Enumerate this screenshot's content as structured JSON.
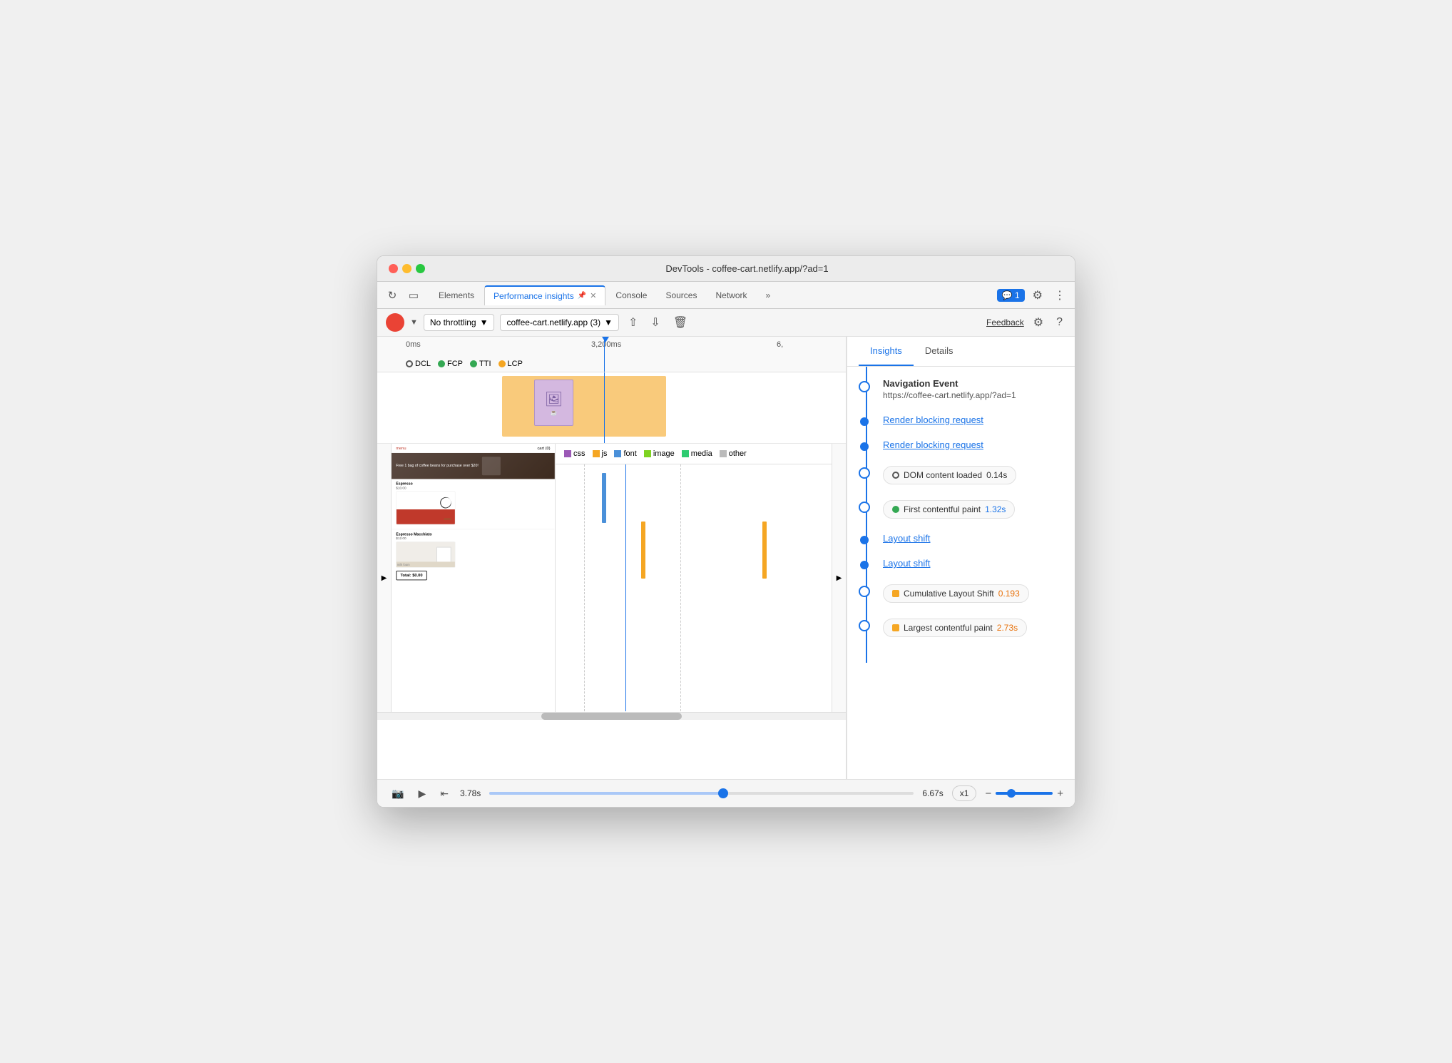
{
  "window": {
    "title": "DevTools - coffee-cart.netlify.app/?ad=1"
  },
  "tabs": {
    "items": [
      {
        "label": "Elements",
        "active": false,
        "closable": false
      },
      {
        "label": "Performance insights",
        "active": true,
        "closable": true,
        "pinned": true
      },
      {
        "label": "Console",
        "active": false,
        "closable": false
      },
      {
        "label": "Sources",
        "active": false,
        "closable": false
      },
      {
        "label": "Network",
        "active": false,
        "closable": false
      },
      {
        "label": "More tabs",
        "active": false
      }
    ],
    "right_buttons": {
      "chat_badge": "1",
      "gear": "⚙",
      "more": "⋮"
    }
  },
  "toolbar": {
    "throttle_label": "No throttling",
    "url_label": "coffee-cart.netlify.app (3)",
    "feedback_label": "Feedback"
  },
  "timeline": {
    "time_start": "0ms",
    "time_mid": "3,200ms",
    "time_end": "6,",
    "legend": {
      "dcl": "DCL",
      "fcp": "FCP",
      "tti": "TTI",
      "lcp": "LCP"
    },
    "resource_types": [
      "css",
      "js",
      "font",
      "image",
      "media",
      "other"
    ],
    "current_time": "3.78s",
    "end_time": "6.67s",
    "playback_speed": "x1"
  },
  "insights": {
    "tab_insights": "Insights",
    "tab_details": "Details",
    "items": [
      {
        "type": "navigation",
        "title": "Navigation Event",
        "subtitle": "https://coffee-cart.netlify.app/?ad=1"
      },
      {
        "type": "link",
        "label": "Render blocking request"
      },
      {
        "type": "link",
        "label": "Render blocking request"
      },
      {
        "type": "chip",
        "chip_type": "circle",
        "chip_label": "DOM content loaded",
        "chip_value": "0.14s",
        "value_color": "normal"
      },
      {
        "type": "chip",
        "chip_type": "green-circle",
        "chip_label": "First contentful paint",
        "chip_value": "1.32s",
        "value_color": "blue"
      },
      {
        "type": "link",
        "label": "Layout shift"
      },
      {
        "type": "link",
        "label": "Layout shift"
      },
      {
        "type": "chip",
        "chip_type": "square",
        "chip_label": "Cumulative Layout Shift",
        "chip_value": "0.193",
        "value_color": "orange"
      },
      {
        "type": "chip",
        "chip_type": "square",
        "chip_label": "Largest contentful paint",
        "chip_value": "2.73s",
        "value_color": "orange"
      }
    ]
  },
  "coffee_site": {
    "nav_menu": "menu",
    "nav_cart": "cart (0)",
    "hero_text": "Free 1 bag of coffee beans for purchase over $20!",
    "item1_name": "Espresso",
    "item1_price": "$10.00",
    "item2_name": "Espresso Macchiato",
    "item2_price": "$12.00",
    "cart_label": "Total: $0.00",
    "sub_label": "milk foam"
  }
}
